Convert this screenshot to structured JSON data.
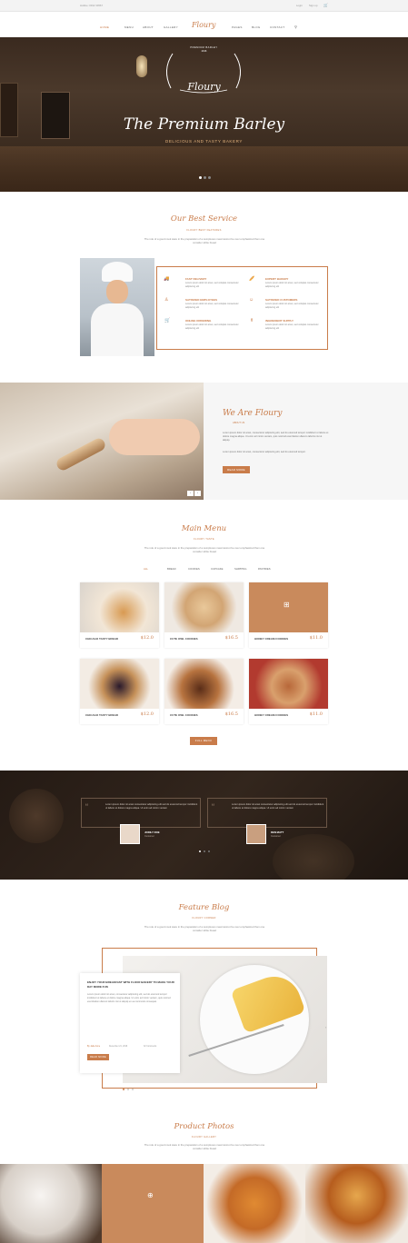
{
  "topbar": {
    "hotline": "Hotline: 0912 34567",
    "login": "Login",
    "signup": "Sign up"
  },
  "nav": {
    "items": [
      "HOME",
      "MENU",
      "ABOUT",
      "GALLERY",
      "PAGES",
      "BLOG",
      "CONTACT"
    ],
    "logo": "Floury"
  },
  "hero": {
    "badge_top": "PREMIUM BARLEY",
    "badge_bottom": "2016",
    "logo": "Floury",
    "title": "The Premium Barley",
    "subtitle": "DELICIOUS AND TASTY BAKERY"
  },
  "services": {
    "title": "Our Best Service",
    "subtitle": "FLOURY BEST FEATURES",
    "desc": "The role of a good cook ware in the preparation of a sumptuous meal cannot be over emphasized then one consider white bread",
    "items": [
      {
        "title": "FAST DELIVERY",
        "text": "Lorem ipsum dolor sit amet, sed volutpat consectetur adipiscing elit"
      },
      {
        "title": "EXPERT BAKERY",
        "text": "Lorem ipsum dolor sit amet, sed volutpat consectetur adipiscing elit"
      },
      {
        "title": "SATISFIED EMPLOYEES",
        "text": "Lorem ipsum dolor sit amet, sed volutpat consectetur adipiscing elit"
      },
      {
        "title": "SATISFIED CUSTOMERS",
        "text": "Lorem ipsum dolor sit amet, sed volutpat consectetur adipiscing elit"
      },
      {
        "title": "ONLINE ORDERING",
        "text": "Lorem ipsum dolor sit amet, sed volutpat consectetur adipiscing elit"
      },
      {
        "title": "INGREDIENT SUPPLY",
        "text": "Lorem ipsum dolor sit amet, sed volutpat consectetur adipiscing elit"
      }
    ]
  },
  "about": {
    "title": "We Are Floury",
    "subtitle": "ABOUT US",
    "text": "Lorem ipsum dolor sit amet, consectetur adipiscing elit, sed do eiusmod tempor incididunt ut labore et dolore magna aliqua. Ut enim ad minim veniam, quis nostrud exercitation ullamco laboris nisi ut aliquip.",
    "text2": "Lorem ipsum dolor sit amet, consectetur adipiscing elit, sed do eiusmod tempor.",
    "button": "READ MORE"
  },
  "menu": {
    "title": "Main Menu",
    "subtitle": "FLOURY TASTE",
    "desc": "The role of a good cook ware in the preparation of a sumptuous meal cannot be over emphasized then one consider white bread",
    "filters": [
      "ALL",
      "BREAD",
      "COOKIES",
      "CUPCAKE",
      "SHIPPING",
      "PASTRIES"
    ],
    "items": [
      {
        "name": "CHICAGO TASTY BREAD",
        "price": "$12.0"
      },
      {
        "name": "CUTE OWL COOKIES",
        "price": "$16.5"
      },
      {
        "name": "HONEY CREAM COOKIES",
        "price": "$11.0"
      },
      {
        "name": "CHICAGO TASTY BREAD",
        "price": "$12.0"
      },
      {
        "name": "CUTE OWL COOKIES",
        "price": "$16.5"
      },
      {
        "name": "HONEY CREAM COOKIES",
        "price": "$11.0"
      }
    ],
    "button": "FULL MENU"
  },
  "testimonials": [
    {
      "text": "Lorem ipsum dolor sit amet consectetur adipiscing elit sed do eiusmod tempor incididunt ut labore et dolore magna aliqua. Ut enim ad minim veniam",
      "name": "JODILY DOE",
      "role": "Customer"
    },
    {
      "text": "Lorem ipsum dolor sit amet consectetur adipiscing elit sed do eiusmod tempor incididunt ut labore et dolore magna aliqua. Ut enim ad minim veniam",
      "name": "DEN MATT",
      "role": "Customer"
    }
  ],
  "blog": {
    "title": "Feature Blog",
    "subtitle": "FLOURY CORNER",
    "desc": "The role of a good cook ware in the preparation of a sumptuous meal cannot be over emphasized then one consider white bread",
    "post_title": "ENJOY YOUR BREAKFAST WITH FLOUR BAKERY TO MAKE YOUR DAY MORE FUN",
    "post_text": "Lorem ipsum dolor sit amet, consectetur adipiscing elit, sed do eiusmod tempor incididunt ut labore et dolore magna aliqua. Ut enim ad minim veniam, quis nostrud exercitation ullamco laboris nisi ut aliquip ex ea commodo consequat.",
    "author": "By Jade Anne",
    "date": "December 21, 2016",
    "comments": "32 Comments",
    "button": "READ MORE"
  },
  "photos": {
    "title": "Product Photos",
    "subtitle": "FLOURY GALLERY",
    "desc": "The role of a good cook ware in the preparation of a sumptuous meal cannot be over emphasized then one consider white bread"
  },
  "colors": {
    "accent": "#c97c4a",
    "dark": "#2b2019"
  }
}
